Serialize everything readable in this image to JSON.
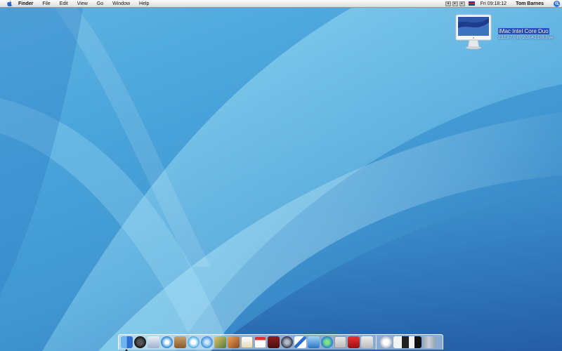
{
  "menubar": {
    "app_name": "Finder",
    "menus": [
      "File",
      "Edit",
      "View",
      "Go",
      "Window",
      "Help"
    ],
    "clock": "Fri 09:18:12",
    "user": "Tom Barnes"
  },
  "desktop_icon": {
    "name": "iMac Intel Core Duo",
    "info": "232.87 GB, 202.43 GB free"
  },
  "dock": {
    "apps": [
      "finder-icon",
      "dashboard-icon",
      "mail-icon",
      "safari-icon",
      "address-book-icon",
      "itunes-icon",
      "quicktime-icon",
      "iphoto-icon",
      "garageband-icon",
      "textedit-icon",
      "ical-icon",
      "dictionary-icon",
      "network-icon",
      "pencil-icon",
      "preview-icon",
      "ichat-icon",
      "calendar-red-icon",
      "pdf-icon",
      "photo-booth-icon"
    ],
    "others": [
      "downloads-icon",
      "gallery-icon",
      "trash-icon"
    ]
  }
}
